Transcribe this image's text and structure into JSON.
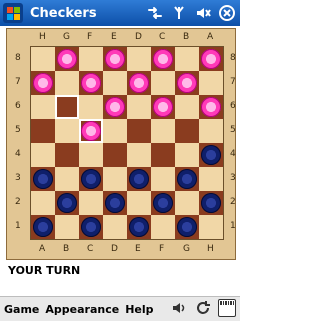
{
  "app": {
    "title": "Checkers",
    "start_icon": "windows-flag-icon",
    "title_icons": [
      "network-icon",
      "signal-icon",
      "volume-icon",
      "close-icon"
    ]
  },
  "board": {
    "top_labels": [
      "H",
      "G",
      "F",
      "E",
      "D",
      "C",
      "B",
      "A"
    ],
    "bottom_labels": [
      "A",
      "B",
      "C",
      "D",
      "E",
      "F",
      "G",
      "H"
    ],
    "left_labels": [
      "8",
      "7",
      "6",
      "5",
      "4",
      "3",
      "2",
      "1"
    ],
    "right_labels": [
      "8",
      "7",
      "6",
      "5",
      "4",
      "3",
      "2",
      "1"
    ],
    "pieces": [
      [
        "",
        "pink",
        "",
        "pink",
        "",
        "pink",
        "",
        "pink"
      ],
      [
        "pink",
        "",
        "pink",
        "",
        "pink",
        "",
        "pink",
        ""
      ],
      [
        "",
        "",
        "",
        "pink",
        "",
        "pink",
        "",
        "pink"
      ],
      [
        "",
        "",
        "pink",
        "",
        "",
        "",
        "",
        ""
      ],
      [
        "",
        "",
        "",
        "",
        "",
        "",
        "",
        "blue"
      ],
      [
        "blue",
        "",
        "blue",
        "",
        "blue",
        "",
        "blue",
        ""
      ],
      [
        "",
        "blue",
        "",
        "blue",
        "",
        "blue",
        "",
        "blue"
      ],
      [
        "blue",
        "",
        "blue",
        "",
        "blue",
        "",
        "blue",
        ""
      ]
    ],
    "highlights": [
      "row2col1",
      "row3col2"
    ],
    "colors": {
      "light": "#f1d7a7",
      "dark": "#8a3c1f",
      "pink": "#ff3ab8",
      "blue": "#0f1f6a"
    }
  },
  "status": {
    "text": "YOUR TURN"
  },
  "menu": {
    "items": [
      "Game",
      "Appearance",
      "Help"
    ],
    "icons": [
      "volume-icon",
      "refresh-icon",
      "keyboard-icon"
    ]
  }
}
